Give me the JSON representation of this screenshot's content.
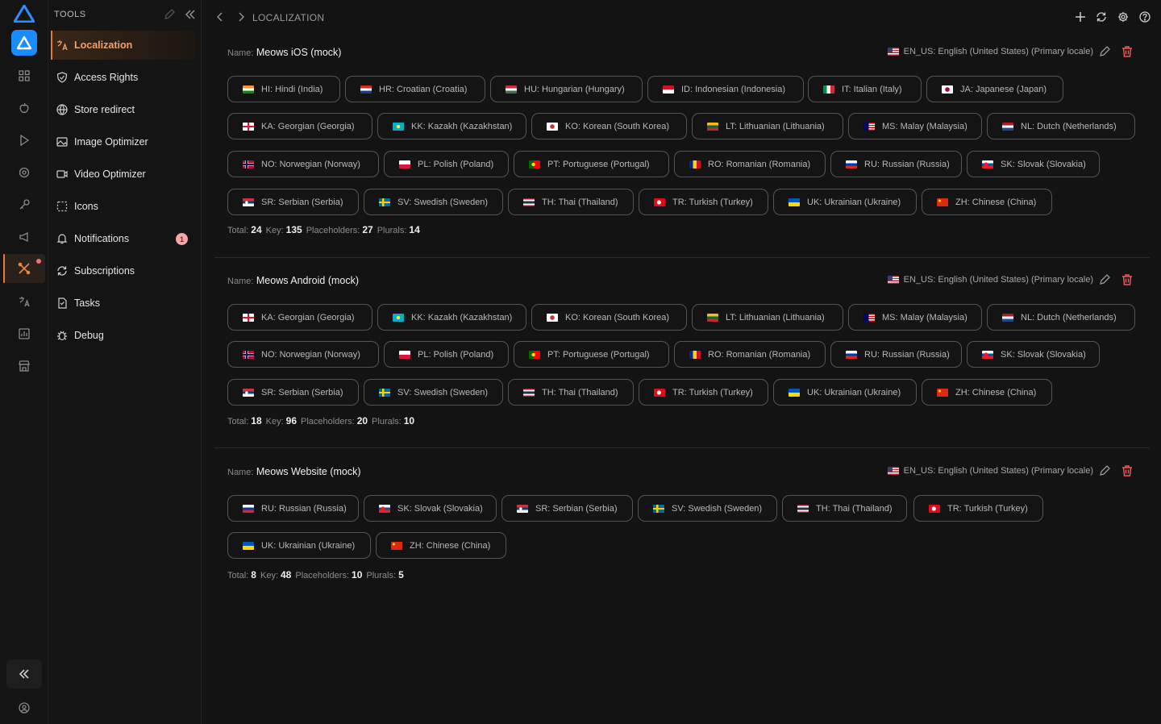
{
  "sidebar": {
    "title": "TOOLS",
    "items": [
      {
        "label": "Localization",
        "icon": "translate-icon",
        "active": true
      },
      {
        "label": "Access Rights",
        "icon": "shield-icon"
      },
      {
        "label": "Store redirect",
        "icon": "globe-icon"
      },
      {
        "label": "Image Optimizer",
        "icon": "image-icon"
      },
      {
        "label": "Video Optimizer",
        "icon": "video-icon"
      },
      {
        "label": "Icons",
        "icon": "icons-icon"
      },
      {
        "label": "Notifications",
        "icon": "bell-icon",
        "badge": "1"
      },
      {
        "label": "Subscriptions",
        "icon": "refresh-icon"
      },
      {
        "label": "Tasks",
        "icon": "document-icon"
      },
      {
        "label": "Debug",
        "icon": "bug-icon"
      }
    ]
  },
  "header": {
    "title": "LOCALIZATION"
  },
  "colors": {
    "accent": "#e07b3a",
    "brand": "#1a8cff",
    "badge": "#f6a7a7"
  },
  "projects": [
    {
      "name_label": "Name:",
      "name": "Meows iOS (mock)",
      "primary": "EN_US: English (United States) (Primary locale)",
      "chips": [
        "HI: Hindi (India)",
        "HR: Croatian (Croatia)",
        "HU: Hungarian (Hungary)",
        "ID: Indonesian (Indonesia)",
        "IT: Italian (Italy)",
        "JA: Japanese (Japan)",
        "KA: Georgian (Georgia)",
        "KK: Kazakh (Kazakhstan)",
        "KO: Korean (South Korea)",
        "LT: Lithuanian (Lithuania)",
        "MS: Malay (Malaysia)",
        "NL: Dutch (Netherlands)",
        "NO: Norwegian (Norway)",
        "PL: Polish (Poland)",
        "PT: Portuguese (Portugal)",
        "RO: Romanian (Romania)",
        "RU: Russian (Russia)",
        "SK: Slovak (Slovakia)",
        "SR: Serbian (Serbia)",
        "SV: Swedish (Sweden)",
        "TH: Thai (Thailand)",
        "TR: Turkish (Turkey)",
        "UK: Ukrainian (Ukraine)",
        "ZH: Chinese (China)"
      ],
      "stats": {
        "total_label": "Total:",
        "total": "24",
        "key_label": "Key:",
        "key": "135",
        "placeholders_label": "Placeholders:",
        "placeholders": "27",
        "plurals_label": "Plurals:",
        "plurals": "14"
      }
    },
    {
      "name_label": "Name:",
      "name": "Meows Android (mock)",
      "primary": "EN_US: English (United States) (Primary locale)",
      "chips": [
        "KA: Georgian (Georgia)",
        "KK: Kazakh (Kazakhstan)",
        "KO: Korean (South Korea)",
        "LT: Lithuanian (Lithuania)",
        "MS: Malay (Malaysia)",
        "NL: Dutch (Netherlands)",
        "NO: Norwegian (Norway)",
        "PL: Polish (Poland)",
        "PT: Portuguese (Portugal)",
        "RO: Romanian (Romania)",
        "RU: Russian (Russia)",
        "SK: Slovak (Slovakia)",
        "SR: Serbian (Serbia)",
        "SV: Swedish (Sweden)",
        "TH: Thai (Thailand)",
        "TR: Turkish (Turkey)",
        "UK: Ukrainian (Ukraine)",
        "ZH: Chinese (China)"
      ],
      "stats": {
        "total_label": "Total:",
        "total": "18",
        "key_label": "Key:",
        "key": "96",
        "placeholders_label": "Placeholders:",
        "placeholders": "20",
        "plurals_label": "Plurals:",
        "plurals": "10"
      }
    },
    {
      "name_label": "Name:",
      "name": "Meows Website (mock)",
      "primary": "EN_US: English (United States) (Primary locale)",
      "chips": [
        "RU: Russian (Russia)",
        "SK: Slovak (Slovakia)",
        "SR: Serbian (Serbia)",
        "SV: Swedish (Sweden)",
        "TH: Thai (Thailand)",
        "TR: Turkish (Turkey)",
        "UK: Ukrainian (Ukraine)",
        "ZH: Chinese (China)"
      ],
      "stats": {
        "total_label": "Total:",
        "total": "8",
        "key_label": "Key:",
        "key": "48",
        "placeholders_label": "Placeholders:",
        "placeholders": "10",
        "plurals_label": "Plurals:",
        "plurals": "5"
      }
    }
  ]
}
